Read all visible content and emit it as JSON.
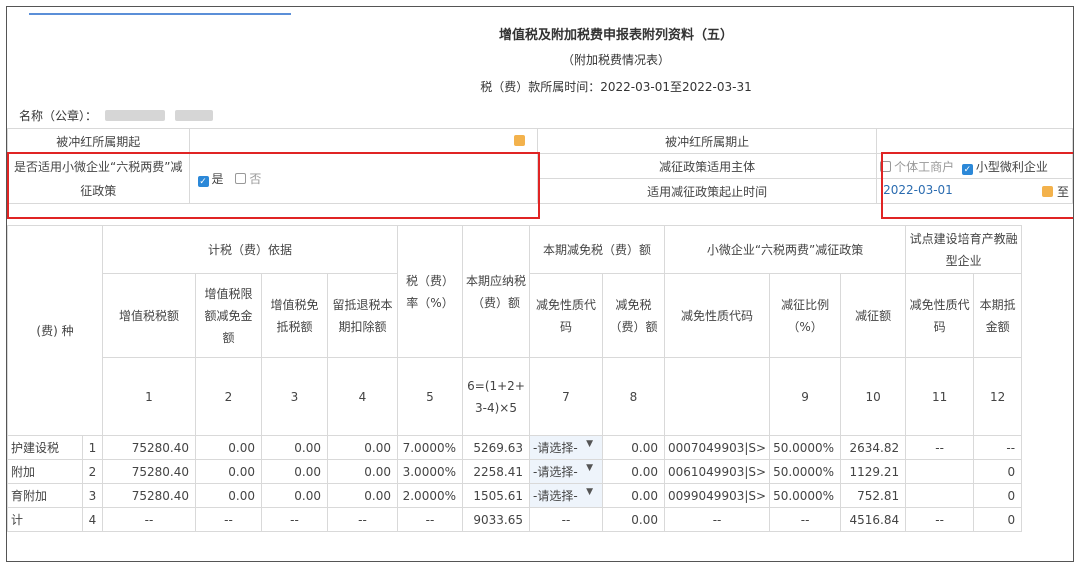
{
  "header": {
    "title": "增值税及附加税费申报表附列资料（五）",
    "subtitle": "（附加税费情况表）",
    "period": "税（费）款所属时间：2022-03-01至2022-03-31"
  },
  "name_label": "名称（公章）：",
  "form": {
    "offset_start_label": "被冲红所属期起",
    "offset_end_label": "被冲红所属期止",
    "policy_label": "是否适用小微企业“六税两费”减征政策",
    "yes_label": "是",
    "no_label": "否",
    "subject_label": "减征政策适用主体",
    "individual_label": "个体工商户",
    "small_label": "小型微利企业",
    "period_label": "适用减征政策起止时间",
    "period_start": "2022-03-01",
    "to_label": "至"
  },
  "table": {
    "group_basis": "计税（费）依据",
    "col_rate": "税（费）率（%）",
    "col_payable": "本期应纳税（费）额",
    "group_relief": "本期减免税（费）额",
    "group_small": "小微企业“六税两费”减征政策",
    "group_pilot": "试点建设培育产教融型企业",
    "col_type": "(费) 种",
    "col_vat": "增值税税额",
    "col_vat_limit": "增值税限额减免金额",
    "col_vat_exempt": "增值税免抵税额",
    "col_refund": "留抵退税本期扣除额",
    "col_relief_code": "减免性质代码",
    "col_relief_amt": "减免税（费）额",
    "col_small_code": "减免性质代码",
    "col_small_ratio": "减征比例（%）",
    "col_small_amt": "减征额",
    "col_pilot_code": "减免性质代码",
    "col_pilot_amt": "本期抵金额",
    "index_row": [
      "1",
      "2",
      "3",
      "4",
      "5",
      "6=(1+2+3-4)×5",
      "7",
      "8",
      "9",
      "10",
      "11",
      "12"
    ],
    "select_placeholder": "-请选择-",
    "rows": [
      {
        "name": "护建设税",
        "idx": "1",
        "vat": "75280.40",
        "limit": "0.00",
        "exempt": "0.00",
        "refund": "0.00",
        "rate": "7.0000%",
        "payable": "5269.63",
        "relief_amt": "0.00",
        "small_code": "0007049903|S>",
        "ratio": "50.0000%",
        "small_amt": "2634.82",
        "pilot_code": "--",
        "pilot_amt": "--"
      },
      {
        "name": "附加",
        "idx": "2",
        "vat": "75280.40",
        "limit": "0.00",
        "exempt": "0.00",
        "refund": "0.00",
        "rate": "3.0000%",
        "payable": "2258.41",
        "relief_amt": "0.00",
        "small_code": "0061049903|S>",
        "ratio": "50.0000%",
        "small_amt": "1129.21",
        "pilot_code": "",
        "pilot_amt": "0"
      },
      {
        "name": "育附加",
        "idx": "3",
        "vat": "75280.40",
        "limit": "0.00",
        "exempt": "0.00",
        "refund": "0.00",
        "rate": "2.0000%",
        "payable": "1505.61",
        "relief_amt": "0.00",
        "small_code": "0099049903|S>",
        "ratio": "50.0000%",
        "small_amt": "752.81",
        "pilot_code": "",
        "pilot_amt": "0"
      }
    ],
    "total": {
      "name": "计",
      "idx": "4",
      "vat": "--",
      "limit": "--",
      "exempt": "--",
      "refund": "--",
      "rate": "--",
      "payable": "9033.65",
      "relief_code": "--",
      "relief_amt": "0.00",
      "small_code": "--",
      "ratio": "--",
      "small_amt": "4516.84",
      "pilot_code": "--",
      "pilot_amt": "0"
    }
  },
  "colors": {
    "highlight": "#e02424",
    "checkbox": "#2b88d8",
    "calendar": "#f3b24c"
  }
}
